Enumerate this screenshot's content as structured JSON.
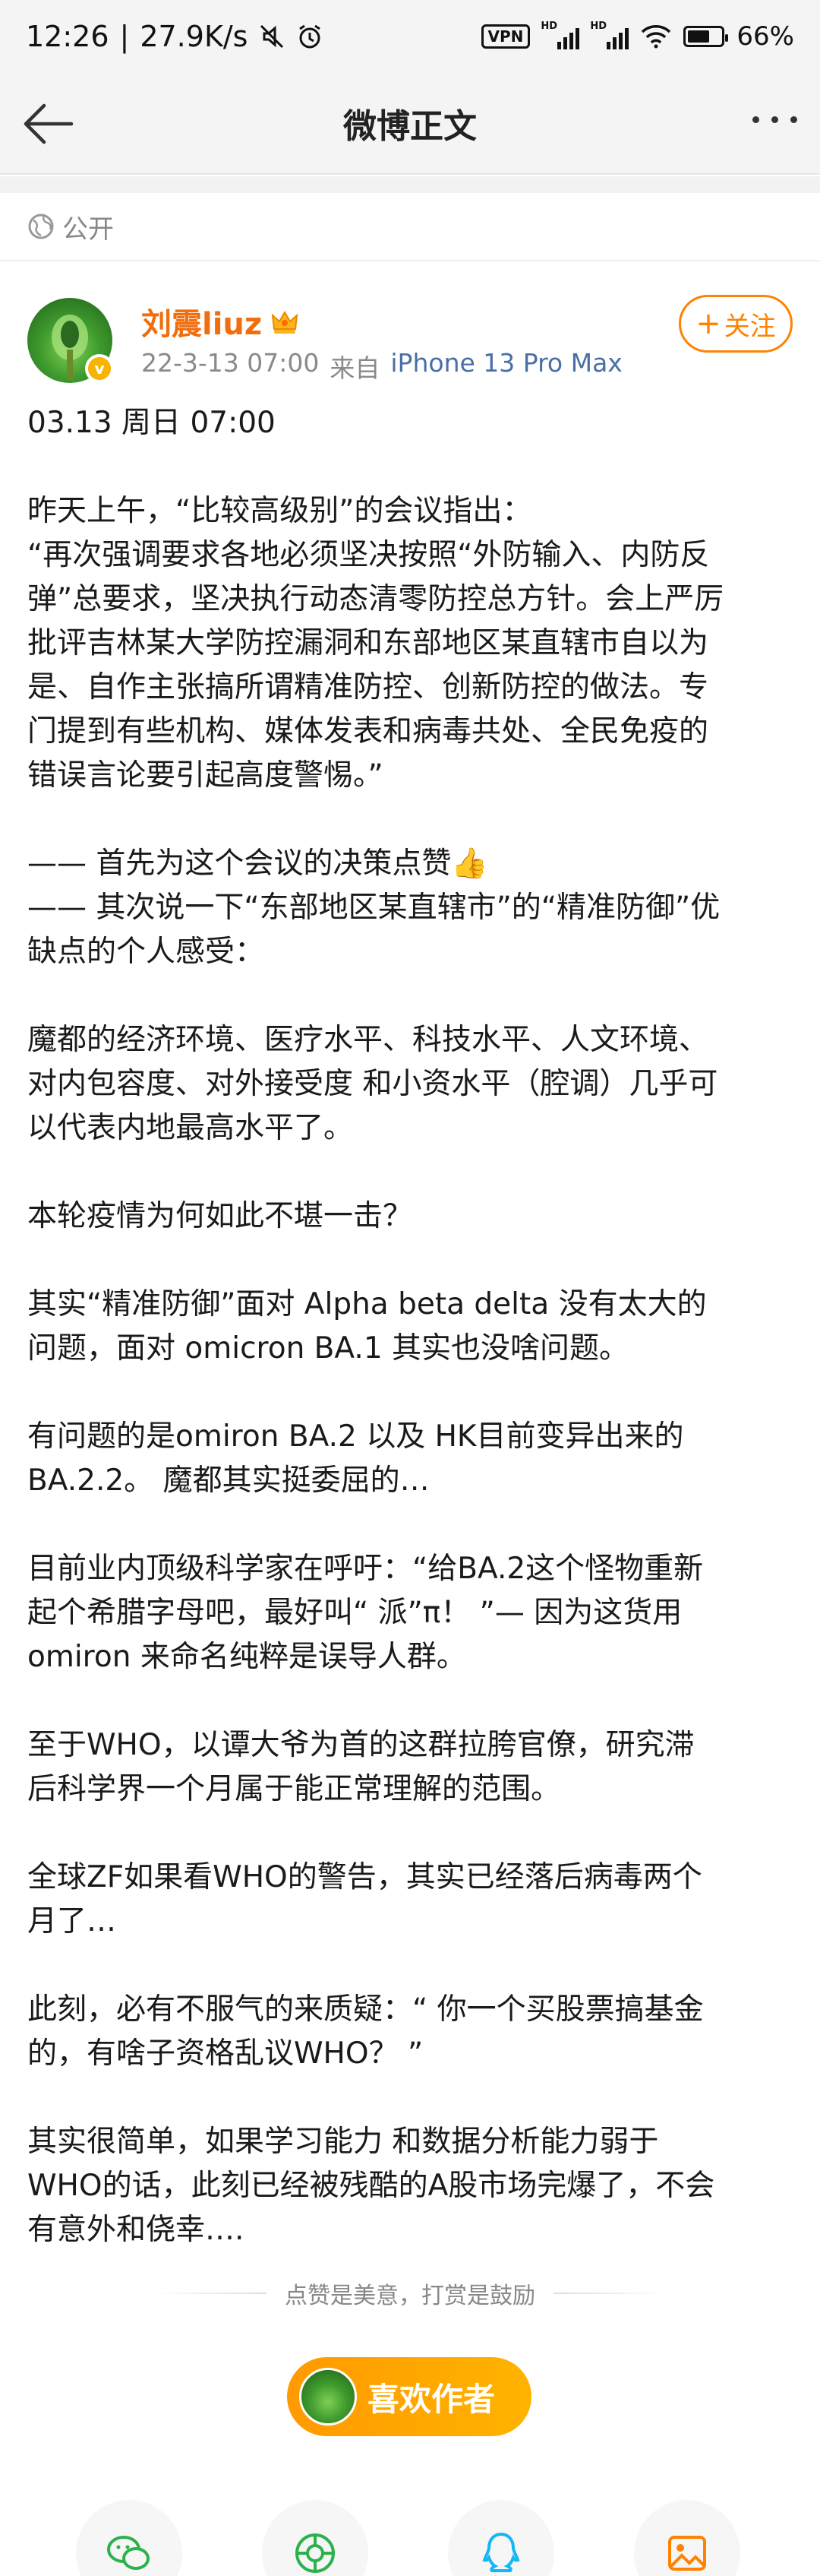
{
  "status_bar": {
    "time": "12:26",
    "net_speed": "27.9K/s",
    "vpn": "VPN",
    "hd_label": "HD",
    "battery_percent": "66%",
    "battery_level": 0.66
  },
  "nav": {
    "title": "微博正文"
  },
  "visibility": {
    "label": "公开"
  },
  "author": {
    "name": "刘震liuz",
    "date": "22-3-13 07:00",
    "source_prefix": "来自",
    "device": "iPhone 13 Pro Max",
    "follow_label": "关注",
    "follow_plus": "+"
  },
  "post": {
    "lines": [
      "03.13 周日 07:00",
      "",
      "昨天上午，“比较高级别”的会议指出：",
      "“再次强调要求各地必须坚决按照“外防输入、内防反",
      "弹”总要求，坚决执行动态清零防控总方针。会上严厉",
      "批评吉林某大学防控漏洞和东部地区某直辖市自以为",
      "是、自作主张搞所谓精准防控、创新防控的做法。专",
      "门提到有些机构、媒体发表和病毒共处、全民免疫的",
      "错误言论要引起高度警惕。”",
      "",
      "—— 首先为这个会议的决策点赞👍",
      "—— 其次说一下“东部地区某直辖市”的“精准防御”优",
      "缺点的个人感受：",
      "",
      "魔都的经济环境、医疗水平、科技水平、人文环境、",
      "对内包容度、对外接受度 和小资水平（腔调）几乎可",
      "以代表内地最高水平了。",
      "",
      "本轮疫情为何如此不堪一击？",
      "",
      "其实“精准防御”面对 Alpha beta delta 没有太大的",
      "问题，面对 omicron BA.1 其实也没啥问题。",
      "",
      "有问题的是omiron BA.2 以及 HK目前变异出来的",
      "BA.2.2。 魔都其实挺委屈的…",
      "",
      "目前业内顶级科学家在呼吁：“给BA.2这个怪物重新",
      "起个希腊字母吧，最好叫“ 派”π！ ”— 因为这货用",
      "omiron 来命名纯粹是误导人群。",
      "",
      "至于WHO，以谭大爷为首的这群拉胯官僚，研究滞",
      "后科学界一个月属于能正常理解的范围。",
      "",
      "全球ZF如果看WHO的警告，其实已经落后病毒两个",
      "月了…",
      "",
      "此刻，必有不服气的来质疑：“ 你一个买股票搞基金",
      "的，有啥子资格乱议WHO？ ”",
      "",
      "其实很简单，如果学习能力 和数据分析能力弱于",
      "WHO的话，此刻已经被残酷的A股市场完爆了，不会",
      "有意外和侥幸…."
    ]
  },
  "reward": {
    "tagline": "点赞是美意，打赏是鼓励",
    "button_label": "喜欢作者"
  },
  "share": {
    "items": [
      "wechat-icon",
      "moments-icon",
      "qq-icon",
      "image-icon"
    ]
  },
  "colors": {
    "accent_orange": "#ff8200",
    "author_name": "#f26d0c",
    "device_blue": "#4a6fa5"
  }
}
